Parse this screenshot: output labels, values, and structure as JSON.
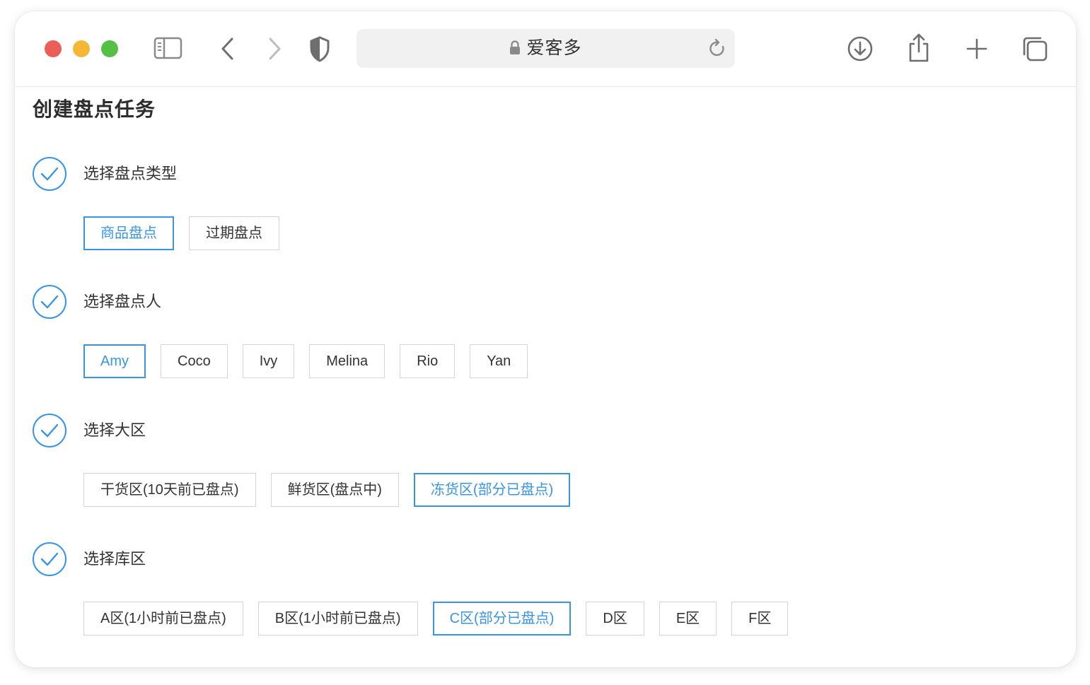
{
  "browser": {
    "address_title": "爱客多",
    "icons": [
      "sidebar-icon",
      "back-icon",
      "forward-icon",
      "shield-icon",
      "lock-icon",
      "reload-icon",
      "download-icon",
      "share-icon",
      "new-tab-icon",
      "tabs-icon"
    ]
  },
  "page": {
    "title": "创建盘点任务"
  },
  "colors": {
    "accent": "#3a94e4",
    "text": "#333333",
    "border": "#d4d4d4"
  },
  "steps": [
    {
      "label": "选择盘点类型",
      "options": [
        {
          "label": "商品盘点",
          "selected": true
        },
        {
          "label": "过期盘点",
          "selected": false
        }
      ]
    },
    {
      "label": "选择盘点人",
      "options": [
        {
          "label": "Amy",
          "selected": true
        },
        {
          "label": "Coco",
          "selected": false
        },
        {
          "label": "Ivy",
          "selected": false
        },
        {
          "label": "Melina",
          "selected": false
        },
        {
          "label": "Rio",
          "selected": false
        },
        {
          "label": "Yan",
          "selected": false
        }
      ]
    },
    {
      "label": "选择大区",
      "options": [
        {
          "label": "干货区(10天前已盘点)",
          "selected": false
        },
        {
          "label": "鲜货区(盘点中)",
          "selected": false
        },
        {
          "label": "冻货区(部分已盘点)",
          "selected": true
        }
      ]
    },
    {
      "label": "选择库区",
      "options": [
        {
          "label": "A区(1小时前已盘点)",
          "selected": false
        },
        {
          "label": "B区(1小时前已盘点)",
          "selected": false
        },
        {
          "label": "C区(部分已盘点)",
          "selected": true
        },
        {
          "label": "D区",
          "selected": false
        },
        {
          "label": "E区",
          "selected": false
        },
        {
          "label": "F区",
          "selected": false
        }
      ]
    }
  ]
}
